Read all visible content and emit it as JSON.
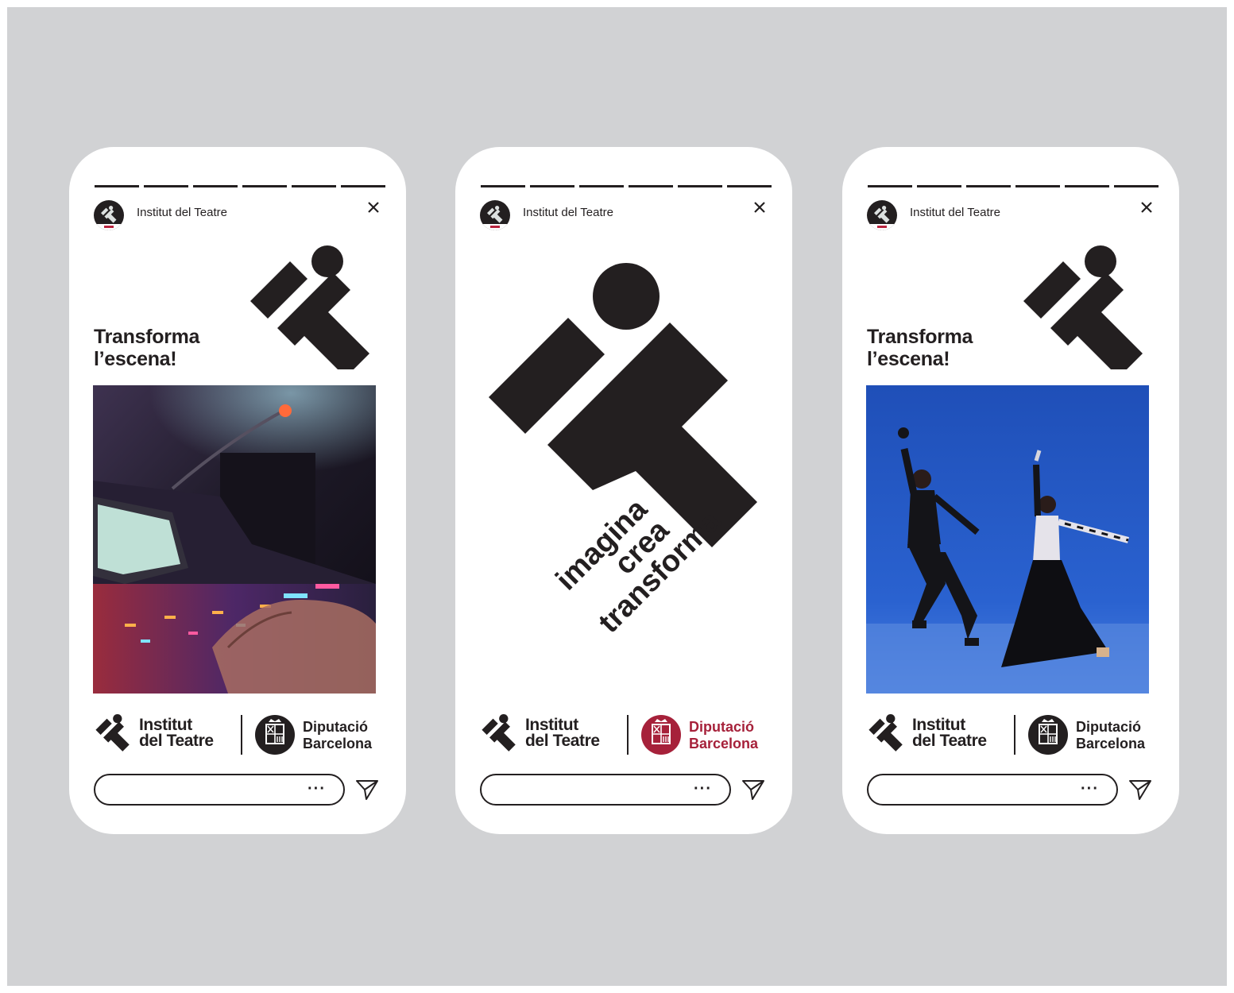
{
  "colors": {
    "background": "#d1d2d4",
    "card": "#ffffff",
    "ink": "#231f20",
    "diputacio_red": "#a6213a"
  },
  "stories": [
    {
      "progress_segments": 6,
      "profile_name": "Institut del Teatre",
      "headline_line1": "Transforma",
      "headline_line2": "l’escena!",
      "photo": "sound-mixing-console",
      "logo_it_line1": "Institut",
      "logo_it_line2": "del Teatre",
      "logo_dip_line1": "Diputació",
      "logo_dip_line2": "Barcelona",
      "reply_more": "···",
      "icons": [
        "avatar",
        "close-icon",
        "it-mark-icon",
        "diputacio-seal-icon",
        "send-icon"
      ]
    },
    {
      "progress_segments": 6,
      "profile_name": "Institut del Teatre",
      "tagline_line1": "imagina",
      "tagline_line2": "crea",
      "tagline_line3": "transforma",
      "logo_it_line1": "Institut",
      "logo_it_line2": "del Teatre",
      "logo_dip_line1": "Diputació",
      "logo_dip_line2": "Barcelona",
      "reply_more": "···",
      "icons": [
        "avatar",
        "close-icon",
        "it-mark-icon",
        "diputacio-seal-icon",
        "send-icon"
      ]
    },
    {
      "progress_segments": 6,
      "profile_name": "Institut del Teatre",
      "headline_line1": "Transforma",
      "headline_line2": "l’escena!",
      "photo": "flamenco-dancers",
      "logo_it_line1": "Institut",
      "logo_it_line2": "del Teatre",
      "logo_dip_line1": "Diputació",
      "logo_dip_line2": "Barcelona",
      "reply_more": "···",
      "icons": [
        "avatar",
        "close-icon",
        "it-mark-icon",
        "diputacio-seal-icon",
        "send-icon"
      ]
    }
  ]
}
